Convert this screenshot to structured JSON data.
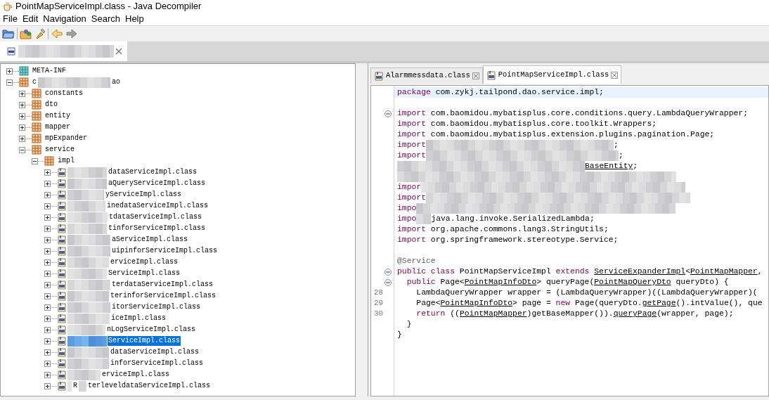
{
  "window": {
    "title": "PointMapServiceImpl.class - Java Decompiler"
  },
  "menu": [
    "File",
    "Edit",
    "Navigation",
    "Search",
    "Help"
  ],
  "file_tabs": [
    {
      "selected": true
    }
  ],
  "tree": [
    {
      "text": [
        "META-INF"
      ],
      "kind": "meta",
      "expanded": false,
      "selected": false
    },
    {
      "text": [
        "c",
        "ao"
      ],
      "kind": "package",
      "expanded": true,
      "selected": false,
      "children": [
        {
          "text": [
            "constants"
          ],
          "kind": "package",
          "expanded": false,
          "selected": false
        },
        {
          "text": [
            "dto"
          ],
          "kind": "package",
          "expanded": false,
          "selected": false
        },
        {
          "text": [
            "entity"
          ],
          "kind": "package",
          "expanded": false,
          "selected": false
        },
        {
          "text": [
            "mapper"
          ],
          "kind": "package",
          "expanded": false,
          "selected": false
        },
        {
          "text": [
            "mpExpander"
          ],
          "kind": "package",
          "expanded": false,
          "selected": false
        },
        {
          "text": [
            "service"
          ],
          "kind": "package",
          "expanded": true,
          "selected": false,
          "children": [
            {
              "text": [
                "impl"
              ],
              "kind": "package",
              "expanded": true,
              "selected": false,
              "children": [
                {
                  "text": [
                    "dataServiceImpl.class"
                  ],
                  "kind": "class",
                  "expanded": false,
                  "selected": false
                },
                {
                  "text": [
                    "aQueryServiceImpl.class"
                  ],
                  "kind": "class",
                  "expanded": false,
                  "selected": false
                },
                {
                  "text": [
                    "yServiceImpl.class"
                  ],
                  "kind": "class",
                  "expanded": false,
                  "selected": false
                },
                {
                  "text": [
                    "inedataServiceImpl.class"
                  ],
                  "kind": "class",
                  "expanded": false,
                  "selected": false
                },
                {
                  "text": [
                    "tdataServiceImpl.class"
                  ],
                  "kind": "class",
                  "expanded": false,
                  "selected": false
                },
                {
                  "text": [
                    "tinforServiceImpl.class"
                  ],
                  "kind": "class",
                  "expanded": false,
                  "selected": false
                },
                {
                  "text": [
                    "aServiceImpl.class"
                  ],
                  "kind": "class",
                  "expanded": false,
                  "selected": false
                },
                {
                  "text": [
                    "uipinforServiceImpl.class"
                  ],
                  "kind": "class",
                  "expanded": false,
                  "selected": false
                },
                {
                  "text": [
                    "erviceImpl.class"
                  ],
                  "kind": "class",
                  "expanded": false,
                  "selected": false
                },
                {
                  "text": [
                    "ServiceImpl.class"
                  ],
                  "kind": "class",
                  "expanded": false,
                  "selected": false
                },
                {
                  "text": [
                    "terdataServiceImpl.class"
                  ],
                  "kind": "class",
                  "expanded": false,
                  "selected": false
                },
                {
                  "text": [
                    "terinforServiceImpl.class"
                  ],
                  "kind": "class",
                  "expanded": false,
                  "selected": false
                },
                {
                  "text": [
                    "itorServiceImpl.class"
                  ],
                  "kind": "class",
                  "expanded": false,
                  "selected": false
                },
                {
                  "text": [
                    "iceImpl.class"
                  ],
                  "kind": "class",
                  "expanded": false,
                  "selected": false
                },
                {
                  "text": [
                    "nLogServiceImpl.class"
                  ],
                  "kind": "class",
                  "expanded": false,
                  "selected": false
                },
                {
                  "text": [
                    "ServiceImpl.class"
                  ],
                  "kind": "class",
                  "expanded": false,
                  "selected": true
                },
                {
                  "text": [
                    "dataServiceImpl.class"
                  ],
                  "kind": "class",
                  "expanded": false,
                  "selected": false
                },
                {
                  "text": [
                    "inforServiceImpl.class"
                  ],
                  "kind": "class",
                  "expanded": false,
                  "selected": false
                },
                {
                  "text": [
                    "erviceImpl.class"
                  ],
                  "kind": "class",
                  "expanded": false,
                  "selected": false
                },
                {
                  "text": [
                    "R",
                    "terleveldataServiceImpl.class"
                  ],
                  "kind": "class",
                  "expanded": false,
                  "selected": false
                }
              ]
            }
          ]
        }
      ]
    }
  ],
  "editor_tabs": [
    {
      "label": "Alarmmessdata.class",
      "selected": false
    },
    {
      "label": "PointMapServiceImpl.class",
      "selected": true
    }
  ],
  "code": [
    {
      "current": true,
      "fold": false,
      "segments": [
        {
          "text": "package",
          "kind": "keyword"
        },
        {
          "text": " com.zykj.tailpond.dao.service.impl;",
          "kind": "plain"
        }
      ]
    },
    {
      "current": false,
      "fold": false
    },
    {
      "current": false,
      "fold": true,
      "segments": [
        {
          "text": "import",
          "kind": "keyword"
        },
        {
          "text": " com.baomidou.mybatisplus.core.conditions.query.LambdaQueryWrapper;",
          "kind": "plain"
        }
      ]
    },
    {
      "current": false,
      "fold": false,
      "segments": [
        {
          "text": "import",
          "kind": "keyword"
        },
        {
          "text": " com.baomidou.mybatisplus.core.toolkit.Wrappers;",
          "kind": "plain"
        }
      ]
    },
    {
      "current": false,
      "fold": false,
      "segments": [
        {
          "text": "import",
          "kind": "keyword"
        },
        {
          "text": " com.baomidou.mybatisplus.extension.plugins.pagination.Page;",
          "kind": "plain"
        }
      ]
    },
    {
      "current": false,
      "fold": false,
      "segments": [
        {
          "text": "import",
          "kind": "keyword"
        },
        {
          "text": ";",
          "kind": "plain"
        }
      ]
    },
    {
      "current": false,
      "fold": false,
      "segments": [
        {
          "text": "import",
          "kind": "keyword"
        },
        {
          "text": ";",
          "kind": "plain"
        }
      ]
    },
    {
      "current": false,
      "fold": false,
      "segments": [
        {
          "text": "BaseEntity",
          "kind": "type"
        },
        {
          "text": ";",
          "kind": "plain"
        }
      ]
    },
    {
      "current": false,
      "fold": false
    },
    {
      "current": false,
      "fold": false,
      "segments": [
        {
          "text": "impor",
          "kind": "keyword"
        }
      ]
    },
    {
      "current": false,
      "fold": false,
      "segments": [
        {
          "text": "import",
          "kind": "keyword"
        }
      ]
    },
    {
      "current": false,
      "fold": false,
      "segments": [
        {
          "text": "impo",
          "kind": "keyword"
        }
      ]
    },
    {
      "current": false,
      "fold": false,
      "segments": [
        {
          "text": "impo",
          "kind": "keyword"
        },
        {
          "text": "java.lang.invoke.SerializedLambda;",
          "kind": "plain"
        }
      ]
    },
    {
      "current": false,
      "fold": false,
      "segments": [
        {
          "text": "import",
          "kind": "keyword"
        },
        {
          "text": " org.apache.commons.lang3.StringUtils;",
          "kind": "plain"
        }
      ]
    },
    {
      "current": false,
      "fold": false,
      "segments": [
        {
          "text": "import",
          "kind": "keyword"
        },
        {
          "text": " org.springframework.stereotype.Service;",
          "kind": "plain"
        }
      ]
    },
    {
      "current": false,
      "fold": false
    },
    {
      "current": false,
      "fold": false,
      "segments": [
        {
          "text": "@Service",
          "kind": "annotation"
        }
      ]
    },
    {
      "current": false,
      "fold": true,
      "segments": [
        {
          "text": "public class",
          "kind": "keyword"
        },
        {
          "text": " PointMapServiceImpl ",
          "kind": "plain"
        },
        {
          "text": "extends ",
          "kind": "keyword"
        },
        {
          "text": "ServiceExpanderImpl",
          "kind": "type"
        },
        {
          "text": "<",
          "kind": "plain"
        },
        {
          "text": "PointMapMapper",
          "kind": "type"
        },
        {
          "text": ",",
          "kind": "plain"
        }
      ]
    },
    {
      "current": false,
      "fold": true,
      "segments": [
        {
          "text": "  public",
          "kind": "keyword"
        },
        {
          "text": " Page<",
          "kind": "plain"
        },
        {
          "text": "PointMapInfoDto",
          "kind": "type"
        },
        {
          "text": "> queryPage(",
          "kind": "plain"
        },
        {
          "text": "PointMapQueryDto",
          "kind": "type"
        },
        {
          "text": " queryDto) {",
          "kind": "plain"
        }
      ]
    },
    {
      "number": "28",
      "current": false,
      "fold": false,
      "segments": [
        {
          "text": "    LambdaQueryWrapper wrapper = (LambdaQueryWrapper)((LambdaQueryWrapper)(",
          "kind": "plain"
        }
      ]
    },
    {
      "number": "29",
      "current": false,
      "fold": false,
      "segments": [
        {
          "text": "    Page<",
          "kind": "plain"
        },
        {
          "text": "PointMapInfoDto",
          "kind": "type"
        },
        {
          "text": "> page = ",
          "kind": "plain"
        },
        {
          "text": "new",
          "kind": "keyword"
        },
        {
          "text": " Page(queryDto.",
          "kind": "plain"
        },
        {
          "text": "getPage",
          "kind": "type"
        },
        {
          "text": "().intValue(), que",
          "kind": "plain"
        }
      ]
    },
    {
      "number": "30",
      "current": false,
      "fold": false,
      "segments": [
        {
          "text": "    return",
          "kind": "keyword"
        },
        {
          "text": " ((",
          "kind": "plain"
        },
        {
          "text": "PointMapMapper",
          "kind": "type"
        },
        {
          "text": ")getBaseMapper()).",
          "kind": "plain"
        },
        {
          "text": "queryPage",
          "kind": "type"
        },
        {
          "text": "(wrapper, page);",
          "kind": "plain"
        }
      ]
    },
    {
      "current": false,
      "fold": false,
      "segments": [
        {
          "text": "  }",
          "kind": "plain"
        }
      ]
    },
    {
      "current": false,
      "fold": false,
      "segments": [
        {
          "text": "}",
          "kind": "plain"
        }
      ]
    }
  ]
}
